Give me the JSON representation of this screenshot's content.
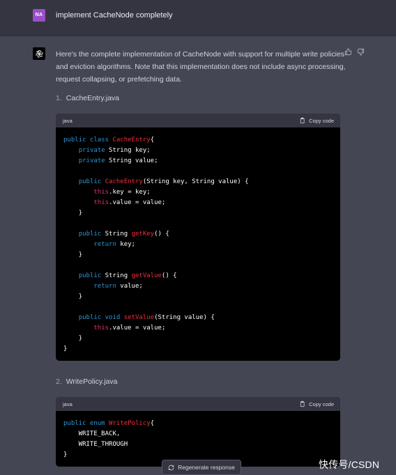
{
  "user": {
    "avatar_initials": "NA",
    "message": "implement CacheNode completely"
  },
  "assistant": {
    "intro": "Here's the complete implementation of CacheNode with support for multiple write policies and eviction algorithms. Note that this implementation does not include async processing, request collapsing, or prefetching data."
  },
  "items": [
    {
      "number": "1.",
      "filename": "CacheEntry.java",
      "lang": "java",
      "copy_label": "Copy code",
      "lines": [
        [
          [
            "kw",
            "public class "
          ],
          [
            "fn",
            "CacheEntry"
          ],
          [
            "",
            "{"
          ]
        ],
        [
          [
            "",
            "    "
          ],
          [
            "kw",
            "private "
          ],
          [
            "",
            "String key;"
          ]
        ],
        [
          [
            "",
            "    "
          ],
          [
            "kw",
            "private "
          ],
          [
            "",
            "String value;"
          ]
        ],
        [
          [
            "",
            ""
          ]
        ],
        [
          [
            "",
            "    "
          ],
          [
            "kw",
            "public "
          ],
          [
            "fn",
            "CacheEntry"
          ],
          [
            "",
            "(String key, String value) {"
          ]
        ],
        [
          [
            "",
            "        "
          ],
          [
            "th",
            "this"
          ],
          [
            "",
            ".key = key;"
          ]
        ],
        [
          [
            "",
            "        "
          ],
          [
            "th",
            "this"
          ],
          [
            "",
            ".value = value;"
          ]
        ],
        [
          [
            "",
            "    }"
          ]
        ],
        [
          [
            "",
            ""
          ]
        ],
        [
          [
            "",
            "    "
          ],
          [
            "kw",
            "public "
          ],
          [
            "",
            "String "
          ],
          [
            "fn",
            "getKey"
          ],
          [
            "",
            "() {"
          ]
        ],
        [
          [
            "",
            "        "
          ],
          [
            "kw",
            "return "
          ],
          [
            "",
            "key;"
          ]
        ],
        [
          [
            "",
            "    }"
          ]
        ],
        [
          [
            "",
            ""
          ]
        ],
        [
          [
            "",
            "    "
          ],
          [
            "kw",
            "public "
          ],
          [
            "",
            "String "
          ],
          [
            "fn",
            "getValue"
          ],
          [
            "",
            "() {"
          ]
        ],
        [
          [
            "",
            "        "
          ],
          [
            "kw",
            "return "
          ],
          [
            "",
            "value;"
          ]
        ],
        [
          [
            "",
            "    }"
          ]
        ],
        [
          [
            "",
            ""
          ]
        ],
        [
          [
            "",
            "    "
          ],
          [
            "kw",
            "public void "
          ],
          [
            "fn",
            "setValue"
          ],
          [
            "",
            "(String value) {"
          ]
        ],
        [
          [
            "",
            "        "
          ],
          [
            "th",
            "this"
          ],
          [
            "",
            ".value = value;"
          ]
        ],
        [
          [
            "",
            "    }"
          ]
        ],
        [
          [
            "",
            "}"
          ]
        ]
      ]
    },
    {
      "number": "2.",
      "filename": "WritePolicy.java",
      "lang": "java",
      "copy_label": "Copy code",
      "lines": [
        [
          [
            "kw",
            "public enum "
          ],
          [
            "fn",
            "WritePolicy"
          ],
          [
            "",
            "{"
          ]
        ],
        [
          [
            "",
            "    WRITE_BACK,"
          ]
        ],
        [
          [
            "",
            "    WRITE_THROUGH"
          ]
        ],
        [
          [
            "",
            "}"
          ]
        ]
      ]
    }
  ],
  "regenerate_label": "Regenerate response",
  "watermark": "快传号/CSDN"
}
